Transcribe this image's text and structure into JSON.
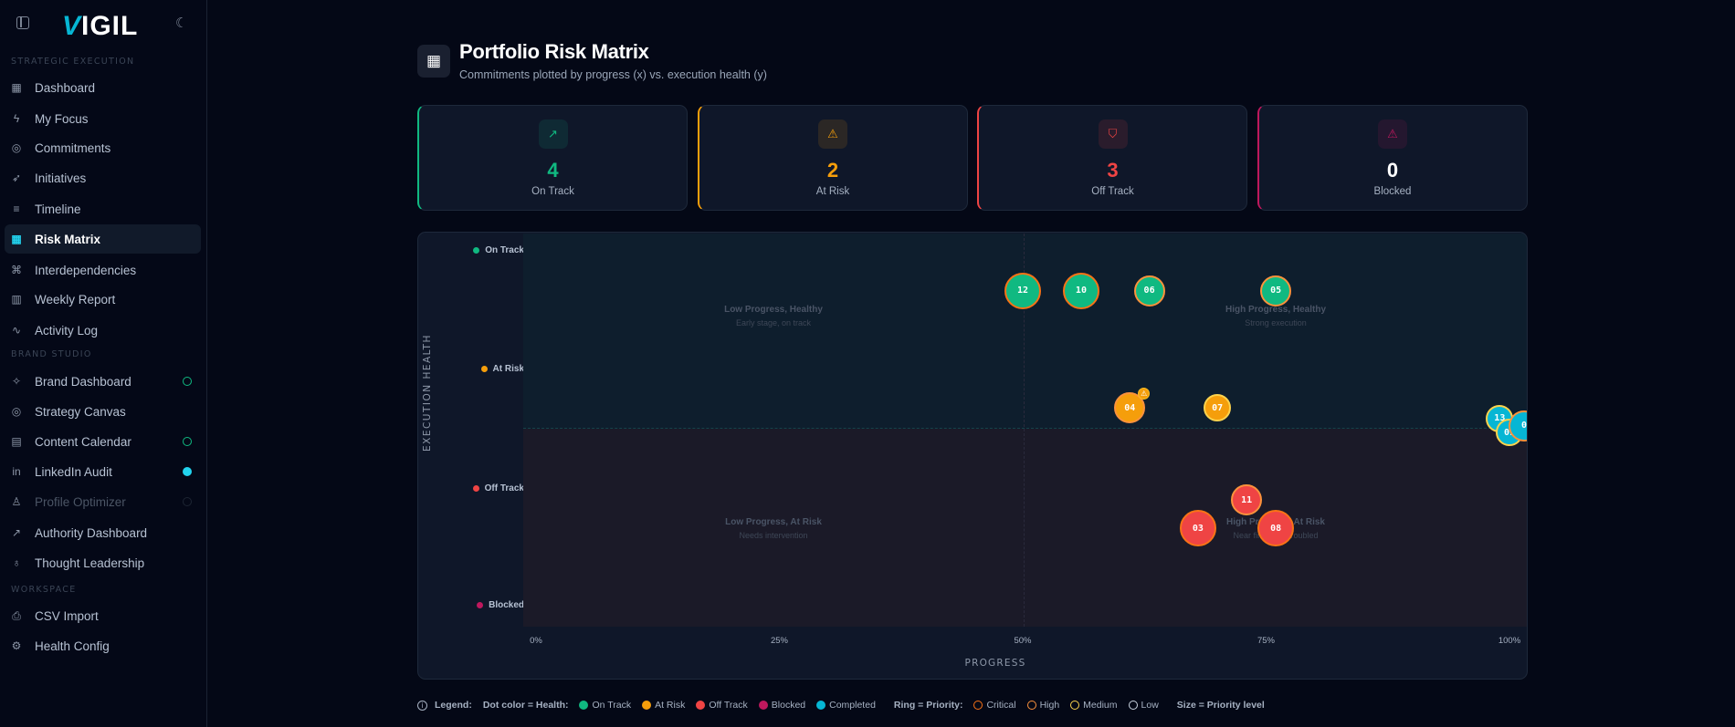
{
  "app": {
    "logo": "VIGIL"
  },
  "sidebar": {
    "sections": [
      {
        "label": "STRATEGIC EXECUTION",
        "items": [
          {
            "label": "Dashboard",
            "icon": "layout-grid-icon"
          },
          {
            "label": "My Focus",
            "icon": "zap-icon"
          },
          {
            "label": "Commitments",
            "icon": "target-icon"
          },
          {
            "label": "Initiatives",
            "icon": "rocket-icon"
          },
          {
            "label": "Timeline",
            "icon": "timeline-icon"
          },
          {
            "label": "Risk Matrix",
            "icon": "grid-icon",
            "active": true
          },
          {
            "label": "Interdependencies",
            "icon": "network-icon"
          },
          {
            "label": "Weekly Report",
            "icon": "bar-chart-icon"
          },
          {
            "label": "Activity Log",
            "icon": "activity-icon"
          }
        ]
      },
      {
        "label": "BRAND STUDIO",
        "items": [
          {
            "label": "Brand Dashboard",
            "icon": "sparkles-icon",
            "status": "complete"
          },
          {
            "label": "Strategy Canvas",
            "icon": "target-icon"
          },
          {
            "label": "Content Calendar",
            "icon": "calendar-icon",
            "status": "complete"
          },
          {
            "label": "LinkedIn Audit",
            "icon": "linkedin-icon",
            "status": "active"
          },
          {
            "label": "Profile Optimizer",
            "icon": "user-check-icon",
            "status": "disabled"
          },
          {
            "label": "Authority Dashboard",
            "icon": "trending-up-icon"
          },
          {
            "label": "Thought Leadership",
            "icon": "award-icon"
          }
        ]
      },
      {
        "label": "WORKSPACE",
        "items": [
          {
            "label": "CSV Import",
            "icon": "file-import-icon"
          },
          {
            "label": "Health Config",
            "icon": "gear-icon"
          }
        ]
      }
    ]
  },
  "header": {
    "title": "Portfolio Risk Matrix",
    "subtitle": "Commitments plotted by progress (x) vs. execution health (y)"
  },
  "summary": [
    {
      "value": "4",
      "label": "On Track",
      "color": "#10b981",
      "icon": "trending-up-icon"
    },
    {
      "value": "2",
      "label": "At Risk",
      "color": "#f59e0b",
      "icon": "warning-icon"
    },
    {
      "value": "3",
      "label": "Off Track",
      "color": "#ef4444",
      "icon": "shield-alert-icon"
    },
    {
      "value": "0",
      "label": "Blocked",
      "color": "#be185d",
      "icon": "warning-icon"
    }
  ],
  "chart_data": {
    "type": "scatter",
    "xlabel": "PROGRESS",
    "ylabel": "EXECUTION HEALTH",
    "xlim": [
      0,
      100
    ],
    "x_ticks": [
      "0%",
      "25%",
      "50%",
      "75%",
      "100%"
    ],
    "y_levels": [
      {
        "label": "On Track",
        "color": "#10b981"
      },
      {
        "label": "At Risk",
        "color": "#f59e0b"
      },
      {
        "label": "Off Track",
        "color": "#ef4444"
      },
      {
        "label": "Blocked",
        "color": "#be185d"
      }
    ],
    "quadrants": {
      "top_left": {
        "title": "Low Progress, Healthy",
        "subtitle": "Early stage, on track"
      },
      "top_right": {
        "title": "High Progress, Healthy",
        "subtitle": "Strong execution"
      },
      "bottom_left": {
        "title": "Low Progress, At Risk",
        "subtitle": "Needs intervention"
      },
      "bottom_right": {
        "title": "High Progress, At Risk",
        "subtitle": "Near finish but troubled"
      }
    },
    "points": [
      {
        "id": "12",
        "progress": 50,
        "health_score": 89,
        "health": "On Track",
        "priority": "Critical"
      },
      {
        "id": "10",
        "progress": 56,
        "health_score": 89,
        "health": "On Track",
        "priority": "Critical"
      },
      {
        "id": "06",
        "progress": 63,
        "health_score": 89,
        "health": "On Track",
        "priority": "High"
      },
      {
        "id": "05",
        "progress": 76,
        "health_score": 89,
        "health": "On Track",
        "priority": "High"
      },
      {
        "id": "04",
        "progress": 61,
        "health_score": 56,
        "health": "At Risk",
        "priority": "High",
        "warning": true
      },
      {
        "id": "07",
        "progress": 70,
        "health_score": 56,
        "health": "At Risk",
        "priority": "Medium"
      },
      {
        "id": "13",
        "progress": 99,
        "health_score": 53,
        "health": "Completed",
        "priority": "Medium"
      },
      {
        "id": "09",
        "progress": 100,
        "health_score": 49,
        "health": "Completed",
        "priority": "Medium"
      },
      {
        "id": "0",
        "progress": 101.5,
        "health_score": 51,
        "health": "Completed",
        "priority": "High"
      },
      {
        "id": "11",
        "progress": 73,
        "health_score": 30,
        "health": "Off Track",
        "priority": "High"
      },
      {
        "id": "03",
        "progress": 68,
        "health_score": 22,
        "health": "Off Track",
        "priority": "Critical"
      },
      {
        "id": "08",
        "progress": 76,
        "health_score": 22,
        "health": "Off Track",
        "priority": "Critical"
      }
    ],
    "health_colors": {
      "On Track": "#10b981",
      "At Risk": "#f59e0b",
      "Off Track": "#ef4444",
      "Blocked": "#be185d",
      "Completed": "#06b6d4"
    },
    "priority_rings": {
      "Critical": "#f97316",
      "High": "#fb923c",
      "Medium": "#fcd34d",
      "Low": "#cbd5e1"
    }
  },
  "legend": {
    "title": "Legend:",
    "dot_label": "Dot color = Health:",
    "health": [
      {
        "label": "On Track",
        "color": "#10b981"
      },
      {
        "label": "At Risk",
        "color": "#f59e0b"
      },
      {
        "label": "Off Track",
        "color": "#ef4444"
      },
      {
        "label": "Blocked",
        "color": "#be185d"
      },
      {
        "label": "Completed",
        "color": "#06b6d4"
      }
    ],
    "ring_label": "Ring = Priority:",
    "priority": [
      {
        "label": "Critical",
        "color": "#f97316"
      },
      {
        "label": "High",
        "color": "#fb923c"
      },
      {
        "label": "Medium",
        "color": "#fcd34d"
      },
      {
        "label": "Low",
        "color": "#cbd5e1"
      }
    ],
    "size_label": "Size = Priority level"
  }
}
